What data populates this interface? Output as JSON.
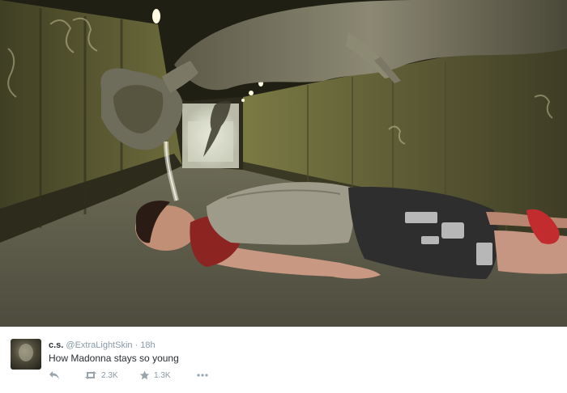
{
  "tweet": {
    "display_name": "c.s.",
    "handle": "@ExtraLightSkin",
    "separator": "·",
    "time": "18h",
    "text": "How Madonna stays so young"
  },
  "actions": {
    "reply_icon": "reply-icon",
    "retweet_icon": "retweet-icon",
    "retweet_count": "2.3K",
    "favorite_icon": "star-icon",
    "favorite_count": "1.3K",
    "more_icon": "more-dots-icon"
  },
  "colors": {
    "text": "#292f33",
    "secondary": "#8899a6",
    "icon": "#99a5ad"
  }
}
